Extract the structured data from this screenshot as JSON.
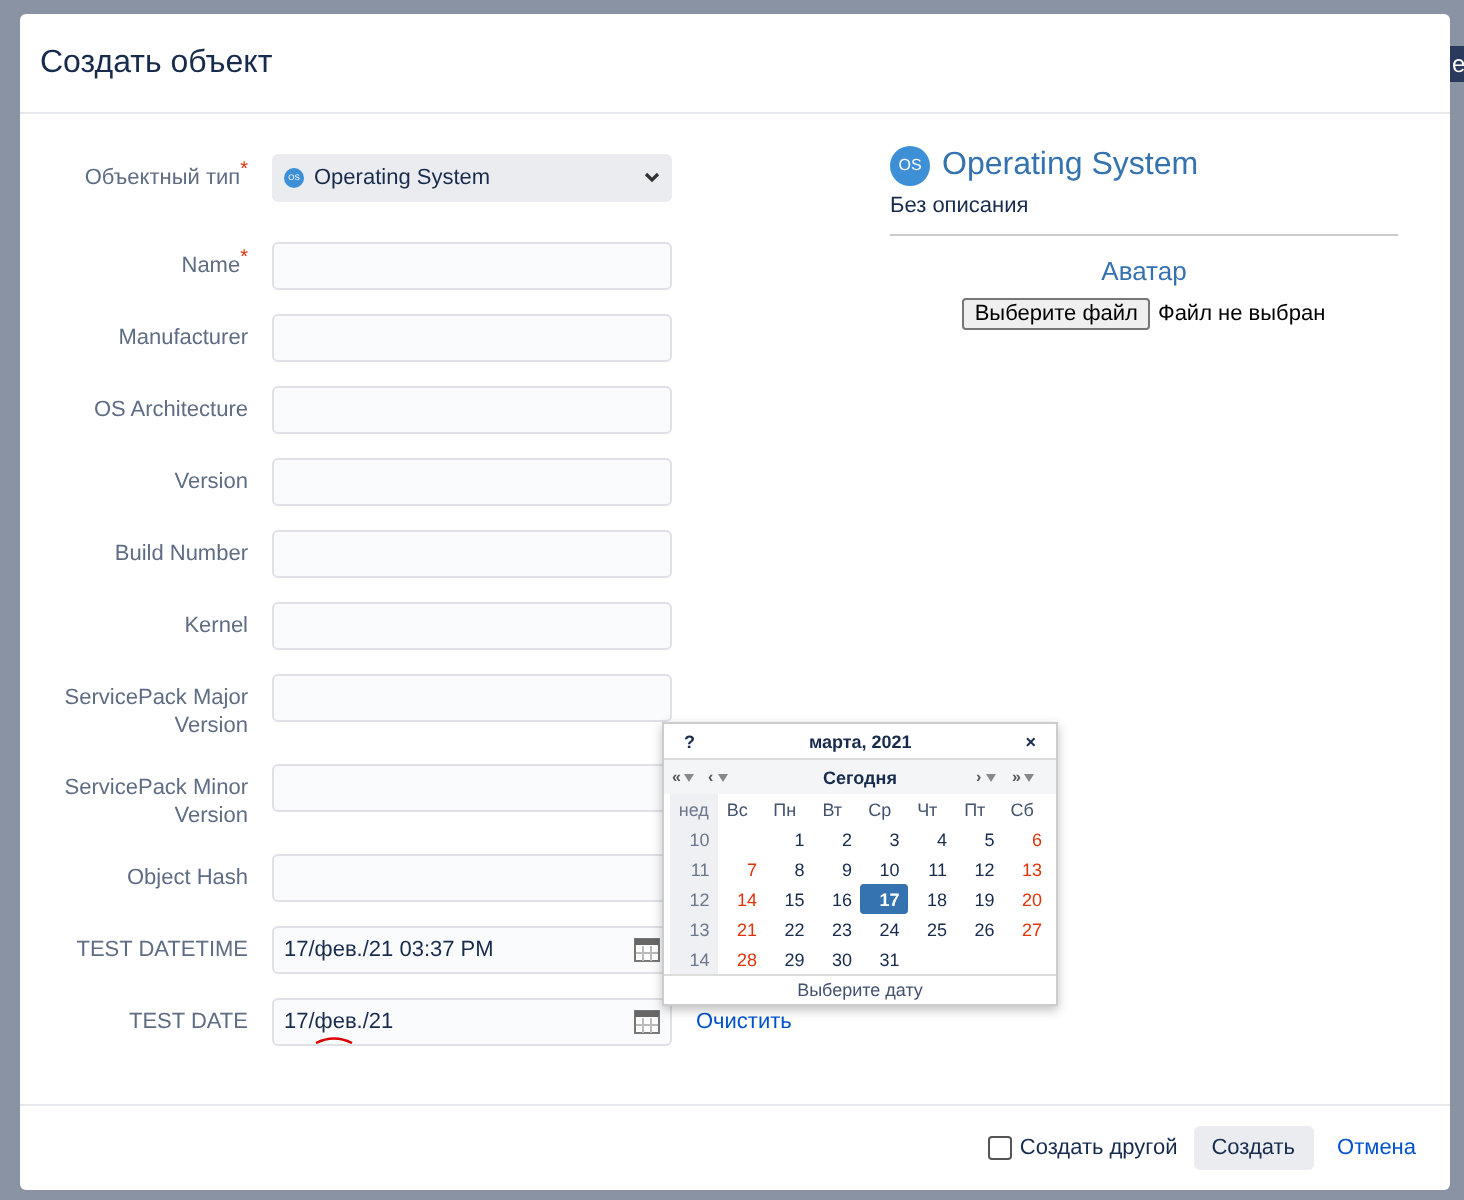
{
  "background_button": {
    "label": "e"
  },
  "dialog": {
    "title": "Создать объект"
  },
  "required_mark": "*",
  "fields": [
    {
      "kind": "select",
      "label": "Объектный тип",
      "required": true,
      "value": "Operating System",
      "icon_text": "OS"
    },
    {
      "kind": "text",
      "label": "Name",
      "required": true
    },
    {
      "kind": "text",
      "label": "Manufacturer",
      "required": false
    },
    {
      "kind": "text",
      "label": "OS Architecture",
      "required": false
    },
    {
      "kind": "text",
      "label": "Version",
      "required": false
    },
    {
      "kind": "text",
      "label": "Build Number",
      "required": false
    },
    {
      "kind": "text",
      "label": "Kernel",
      "required": false
    },
    {
      "kind": "text",
      "label": "ServicePack Major Version",
      "required": false
    },
    {
      "kind": "text",
      "label": "ServicePack Minor Version",
      "required": false
    },
    {
      "kind": "text",
      "label": "Object Hash",
      "required": false
    },
    {
      "kind": "date",
      "label": "TEST DATETIME",
      "required": false,
      "value": "17/фев./21 03:37 PM",
      "spellcheck_error": false
    },
    {
      "kind": "date",
      "label": "TEST DATE",
      "required": false,
      "value": "17/фев./21",
      "spellcheck_error": true,
      "clear_link": "Очистить"
    }
  ],
  "type_panel": {
    "icon_text": "OS",
    "title": "Operating System",
    "description": "Без описания",
    "avatar_heading": "Аватар",
    "file_button": "Выберите файл",
    "file_status": "Файл не выбран"
  },
  "calendar": {
    "help": "?",
    "title": "марта, 2021",
    "close": "×",
    "nav": [
      {
        "label": "«",
        "caret": true
      },
      {
        "label": "‹",
        "caret": true
      },
      {
        "label": "Сегодня",
        "caret": false
      },
      {
        "label": "›",
        "caret": true
      },
      {
        "label": "»",
        "caret": true
      }
    ],
    "week_header": "нед",
    "weekdays": [
      "Вс",
      "Пн",
      "Вт",
      "Ср",
      "Чт",
      "Пт",
      "Сб"
    ],
    "weeks": [
      {
        "week": "10",
        "starts_mid_week": true,
        "days": [
          {
            "label": "1",
            "selected": false
          },
          {
            "label": "2",
            "selected": false
          },
          {
            "label": "3",
            "selected": false
          },
          {
            "label": "4",
            "selected": false
          },
          {
            "label": "5",
            "selected": false
          },
          {
            "label": "6",
            "selected": false
          }
        ]
      },
      {
        "week": "11",
        "days": [
          {
            "label": "7",
            "selected": false
          },
          {
            "label": "8",
            "selected": false
          },
          {
            "label": "9",
            "selected": false
          },
          {
            "label": "10",
            "selected": false
          },
          {
            "label": "11",
            "selected": false
          },
          {
            "label": "12",
            "selected": false
          },
          {
            "label": "13",
            "selected": false
          }
        ]
      },
      {
        "week": "12",
        "days": [
          {
            "label": "14",
            "selected": false
          },
          {
            "label": "15",
            "selected": false
          },
          {
            "label": "16",
            "selected": false
          },
          {
            "label": "17",
            "selected": true
          },
          {
            "label": "18",
            "selected": false
          },
          {
            "label": "19",
            "selected": false
          },
          {
            "label": "20",
            "selected": false
          }
        ]
      },
      {
        "week": "13",
        "days": [
          {
            "label": "21",
            "selected": false
          },
          {
            "label": "22",
            "selected": false
          },
          {
            "label": "23",
            "selected": false
          },
          {
            "label": "24",
            "selected": false
          },
          {
            "label": "25",
            "selected": false
          },
          {
            "label": "26",
            "selected": false
          },
          {
            "label": "27",
            "selected": false
          }
        ]
      },
      {
        "week": "14",
        "starts_mid_week": false,
        "days": [
          {
            "label": "28",
            "selected": false
          },
          {
            "label": "29",
            "selected": false
          },
          {
            "label": "30",
            "selected": false
          },
          {
            "label": "31",
            "selected": false
          }
        ]
      }
    ],
    "footer": "Выберите дату"
  },
  "footer": {
    "create_another": {
      "label": "Создать другой",
      "checked": false
    },
    "submit": "Создать",
    "cancel": "Отмена"
  }
}
